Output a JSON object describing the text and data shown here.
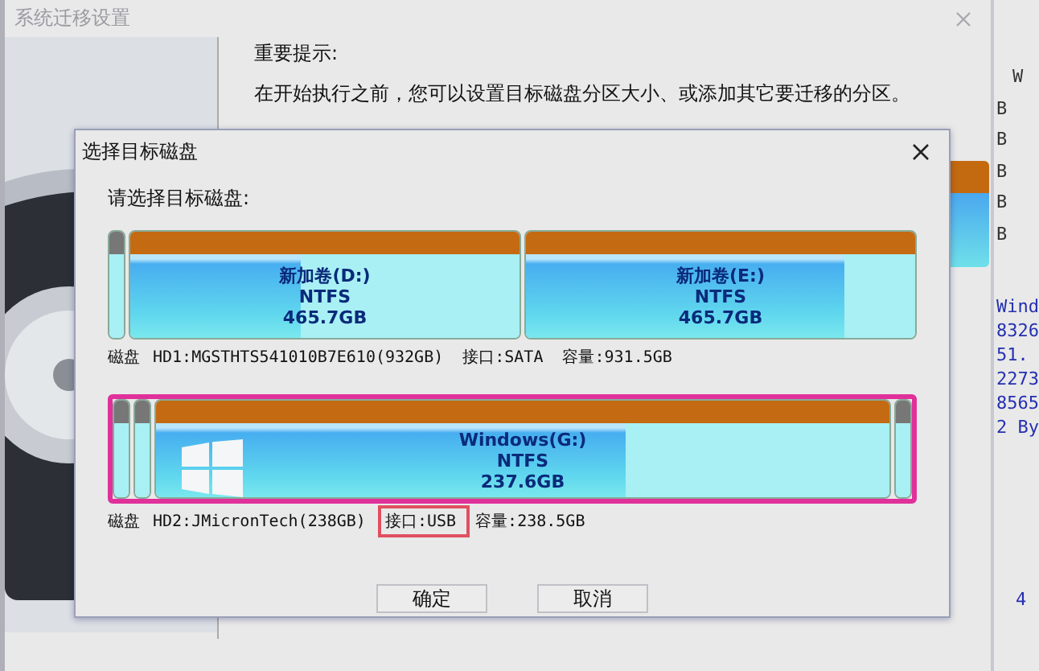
{
  "background_window": {
    "title": "系统迁移设置",
    "notice_title": "重要提示:",
    "notice_text": "在开始执行之前，您可以设置目标磁盘分区大小、或添加其它要迁移的分区。"
  },
  "side_strip": {
    "header": "W",
    "marks": [
      "B",
      "B",
      "B",
      "B",
      "B"
    ],
    "details": [
      "Wind",
      "8326",
      "51.",
      "2273",
      "8565",
      "2 By"
    ],
    "footer": "4"
  },
  "dialog": {
    "title": "选择目标磁盘",
    "prompt": "请选择目标磁盘:",
    "disks": [
      {
        "selected": false,
        "partitions": [
          {
            "kind": "small"
          },
          {
            "kind": "volume",
            "name": "新加卷(D:)",
            "fs": "NTFS",
            "size": "465.7GB",
            "level": 0.44
          },
          {
            "kind": "volume",
            "name": "新加卷(E:)",
            "fs": "NTFS",
            "size": "465.7GB",
            "level": 0.82
          }
        ],
        "info": {
          "label": "磁盘",
          "model": "HD1:MGSTHTS541010B7E610(932GB)",
          "interface": "接口:SATA",
          "interface_highlighted": false,
          "capacity": "容量:931.5GB"
        }
      },
      {
        "selected": true,
        "partitions": [
          {
            "kind": "small"
          },
          {
            "kind": "small"
          },
          {
            "kind": "system",
            "name": "Windows(G:)",
            "fs": "NTFS",
            "size": "237.6GB",
            "level": 0.64
          },
          {
            "kind": "small"
          }
        ],
        "info": {
          "label": "磁盘",
          "model": "HD2:JMicronTech(238GB)",
          "interface": "接口:USB",
          "interface_highlighted": true,
          "capacity": "容量:238.5GB"
        }
      }
    ],
    "buttons": [
      "确定",
      "取消"
    ]
  }
}
